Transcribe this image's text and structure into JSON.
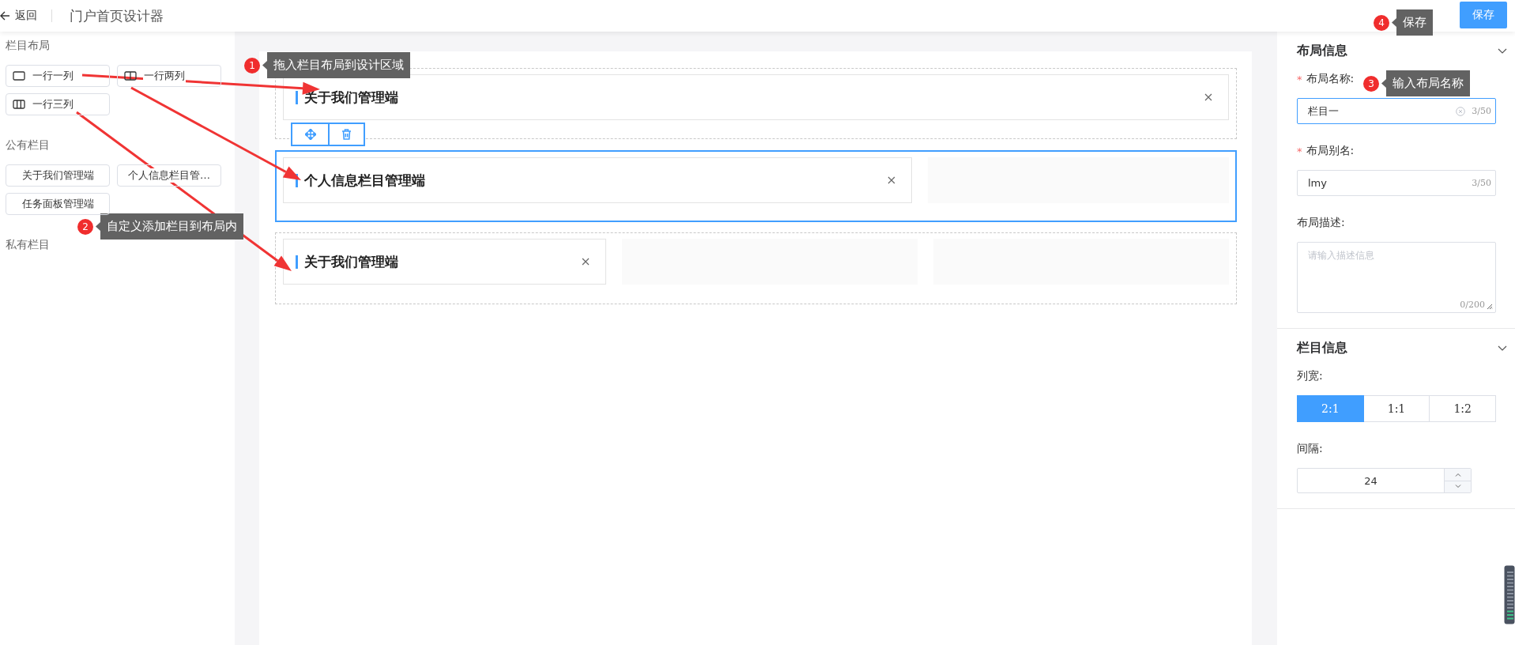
{
  "header": {
    "back_label": "返回",
    "title": "门户首页设计器",
    "save_button": "保存"
  },
  "left_panel": {
    "sections": [
      {
        "title": "栏目布局",
        "items": [
          {
            "kind": "one-column",
            "label": "一行一列"
          },
          {
            "kind": "two-column",
            "label": "一行两列"
          },
          {
            "kind": "three-column",
            "label": "一行三列"
          }
        ]
      },
      {
        "title": "公有栏目",
        "items": [
          {
            "kind": "column",
            "label": "关于我们管理端"
          },
          {
            "kind": "column",
            "label": "个人信息栏目管…"
          },
          {
            "kind": "column",
            "label": "任务面板管理端"
          }
        ]
      },
      {
        "title": "私有栏目"
      }
    ]
  },
  "canvas": {
    "rows": [
      {
        "selected": false,
        "cells": [
          {
            "kind": "card",
            "title": "关于我们管理端"
          }
        ]
      },
      {
        "selected": true,
        "cells": [
          {
            "kind": "card",
            "title": "个人信息栏目管理端"
          },
          {
            "kind": "empty"
          }
        ]
      },
      {
        "selected": false,
        "cells": [
          {
            "kind": "card",
            "title": "关于我们管理端"
          },
          {
            "kind": "empty"
          },
          {
            "kind": "empty"
          }
        ]
      }
    ]
  },
  "right_panel": {
    "sections": [
      {
        "title": "布局信息",
        "expanded": true,
        "fields": [
          {
            "kind": "text",
            "required_mark": "*",
            "label": "布局名称:",
            "value": "栏目一",
            "count": "3/50",
            "focused": true
          },
          {
            "kind": "text",
            "required_mark": "*",
            "label": "布局别名:",
            "value": "lmy",
            "count": "3/50",
            "focused": false
          },
          {
            "kind": "textarea",
            "label": "布局描述:",
            "placeholder": "请输入描述信息",
            "count": "0/200"
          }
        ]
      },
      {
        "title": "栏目信息",
        "expanded": true,
        "fields": [
          {
            "kind": "segmented",
            "label": "列宽:",
            "options": [
              {
                "label": "2:1",
                "kind": "wide-left",
                "selected": true
              },
              {
                "label": "1:1",
                "kind": "equal",
                "selected": false
              },
              {
                "label": "1:2",
                "kind": "wide-right",
                "selected": false
              }
            ]
          },
          {
            "kind": "number",
            "label": "间隔:",
            "value": "24"
          }
        ]
      }
    ]
  },
  "annotations": [
    {
      "number": "4",
      "text": "保存"
    },
    {
      "number": "1",
      "text": "拖入栏目布局到设计区域"
    },
    {
      "number": "3",
      "text": "输入布局名称"
    },
    {
      "number": "2",
      "text": "自定义添加栏目到布局内"
    }
  ]
}
